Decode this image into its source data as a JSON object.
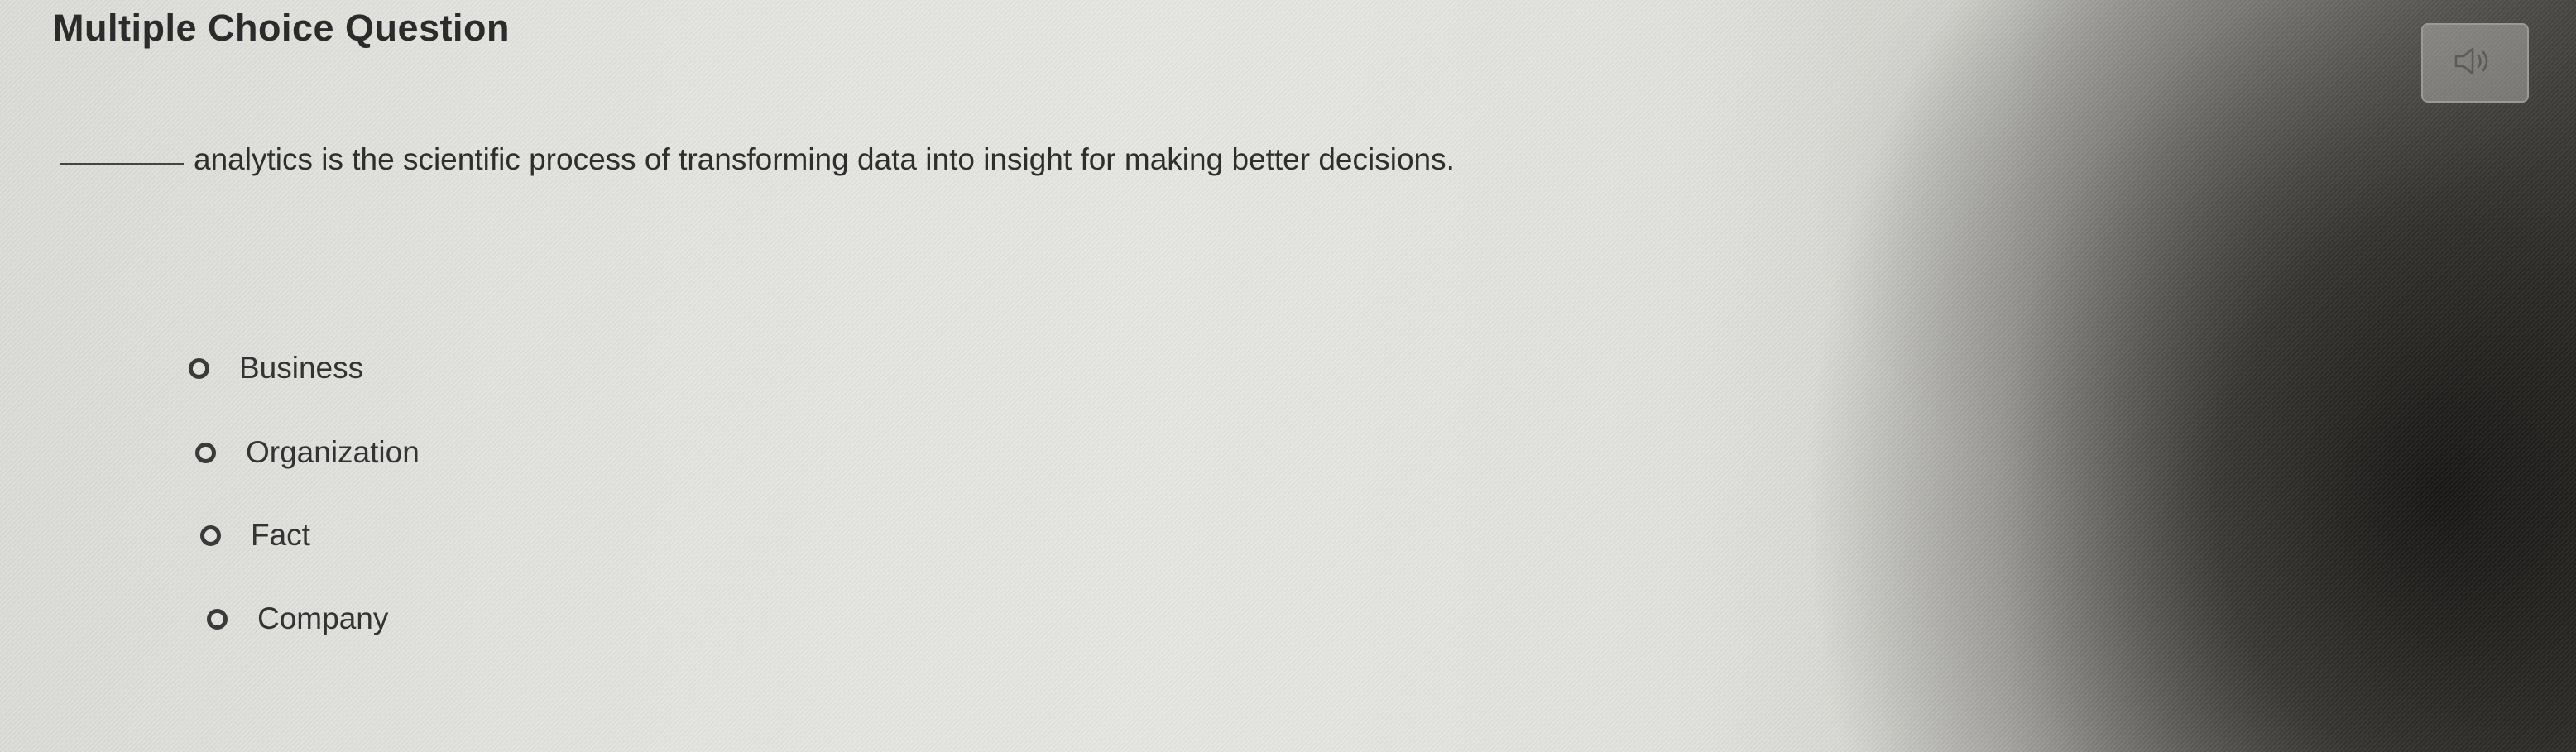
{
  "header": {
    "title": "Multiple Choice Question",
    "audio_icon": "speaker-icon"
  },
  "question": {
    "text": "analytics is the scientific process of transforming data into insight for making better decisions."
  },
  "options": [
    {
      "label": "Business",
      "selected": false
    },
    {
      "label": "Organization",
      "selected": false
    },
    {
      "label": "Fact",
      "selected": false
    },
    {
      "label": "Company",
      "selected": false
    }
  ]
}
